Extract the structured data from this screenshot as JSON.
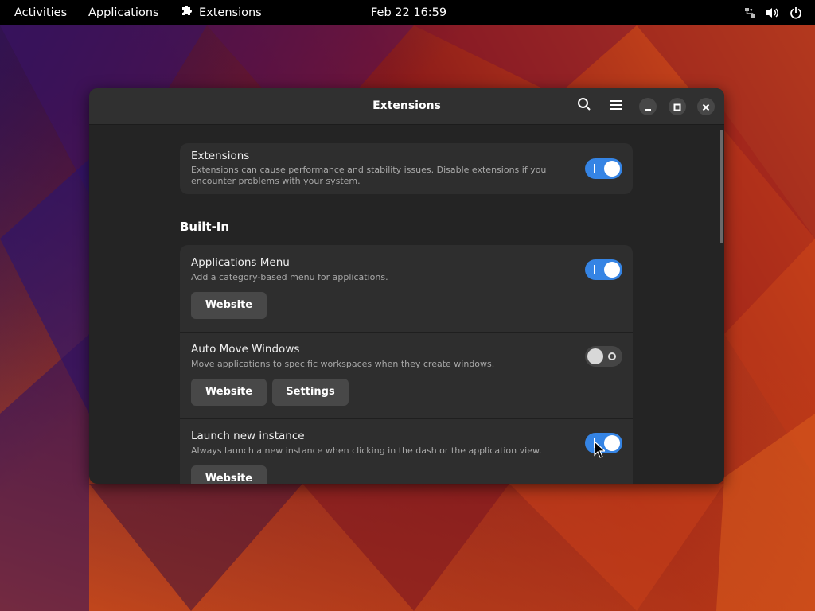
{
  "topbar": {
    "activities": "Activities",
    "applications": "Applications",
    "app_name": "Extensions",
    "clock": "Feb 22  16:59",
    "icons": [
      "network-icon",
      "volume-icon",
      "power-icon"
    ]
  },
  "window": {
    "title": "Extensions",
    "header_icons": [
      "search-icon",
      "hamburger-menu-icon",
      "minimize-icon",
      "maximize-icon",
      "close-icon"
    ]
  },
  "master": {
    "title": "Extensions",
    "description": "Extensions can cause performance and stability issues. Disable extensions if you encounter problems with your system.",
    "enabled": true
  },
  "builtin_heading": "Built-In",
  "extensions": [
    {
      "name": "Applications Menu",
      "description": "Add a category-based menu for applications.",
      "enabled": true,
      "website_label": "Website"
    },
    {
      "name": "Auto Move Windows",
      "description": "Move applications to specific workspaces when they create windows.",
      "enabled": false,
      "website_label": "Website",
      "settings_label": "Settings"
    },
    {
      "name": "Launch new instance",
      "description": "Always launch a new instance when clicking in the dash or the application view.",
      "enabled": true,
      "website_label": "Website"
    }
  ],
  "colors": {
    "accent": "#3584e4",
    "window_bg": "#242424",
    "card_bg": "#2e2e2e",
    "button_bg": "#484848"
  }
}
